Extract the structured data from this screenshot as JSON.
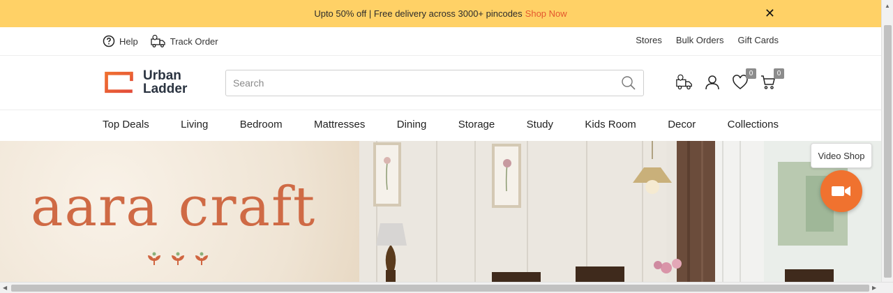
{
  "promo": {
    "text": "Upto 50% off | Free delivery across 3000+ pincodes",
    "link": "Shop Now",
    "close_glyph": "✕"
  },
  "utility": {
    "help": "Help",
    "track_order": "Track Order",
    "stores": "Stores",
    "bulk_orders": "Bulk Orders",
    "gift_cards": "Gift Cards"
  },
  "header": {
    "logo_line1": "Urban",
    "logo_line2": "Ladder",
    "search_placeholder": "Search",
    "wishlist_count": "0",
    "cart_count": "0"
  },
  "nav": {
    "items": [
      "Top Deals",
      "Living",
      "Bedroom",
      "Mattresses",
      "Dining",
      "Storage",
      "Study",
      "Kids Room",
      "Decor",
      "Collections"
    ]
  },
  "hero": {
    "brand": "aara craft"
  },
  "video_shop": {
    "label": "Video Shop"
  },
  "colors": {
    "promo_bg": "#ffd166",
    "accent": "#f0722f",
    "brand_text": "#cf6a45"
  }
}
